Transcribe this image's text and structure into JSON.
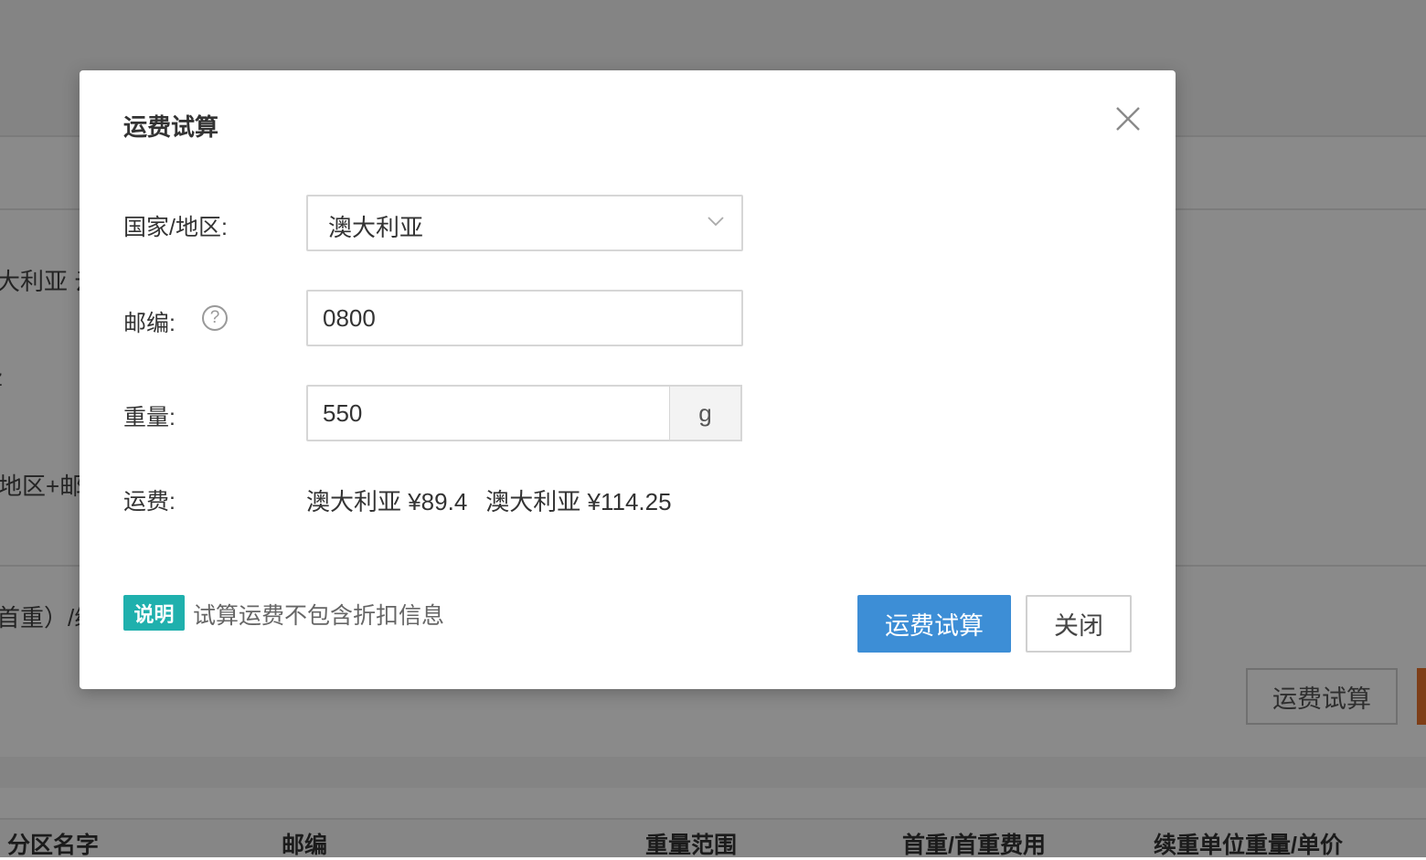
{
  "background": {
    "fragments": [
      "大利亚 云",
      "z",
      "地区+邮编",
      "首重）/续"
    ],
    "estimate_button": "运费试算",
    "table_headers": [
      "分区名字",
      "邮编",
      "重量范围",
      "首重/首重费用",
      "续重单位重量/单价"
    ]
  },
  "dialog": {
    "title": "运费试算",
    "close_icon": "close-icon",
    "country": {
      "label": "国家/地区:",
      "value": "澳大利亚"
    },
    "postcode": {
      "label": "邮编:",
      "value": "0800",
      "help_icon": "question-circle-icon"
    },
    "weight": {
      "label": "重量:",
      "value": "550",
      "unit": "g"
    },
    "fee": {
      "label": "运费:",
      "results": [
        "澳大利亚 ¥89.4",
        "澳大利亚 ¥114.25"
      ]
    },
    "note": {
      "badge": "说明",
      "text": "试算运费不包含折扣信息"
    },
    "buttons": {
      "calculate": "运费试算",
      "close": "关闭"
    }
  },
  "colors": {
    "primary": "#3d8ed6",
    "badge": "#1fb0ad",
    "accent_orange": "#e9742b"
  }
}
